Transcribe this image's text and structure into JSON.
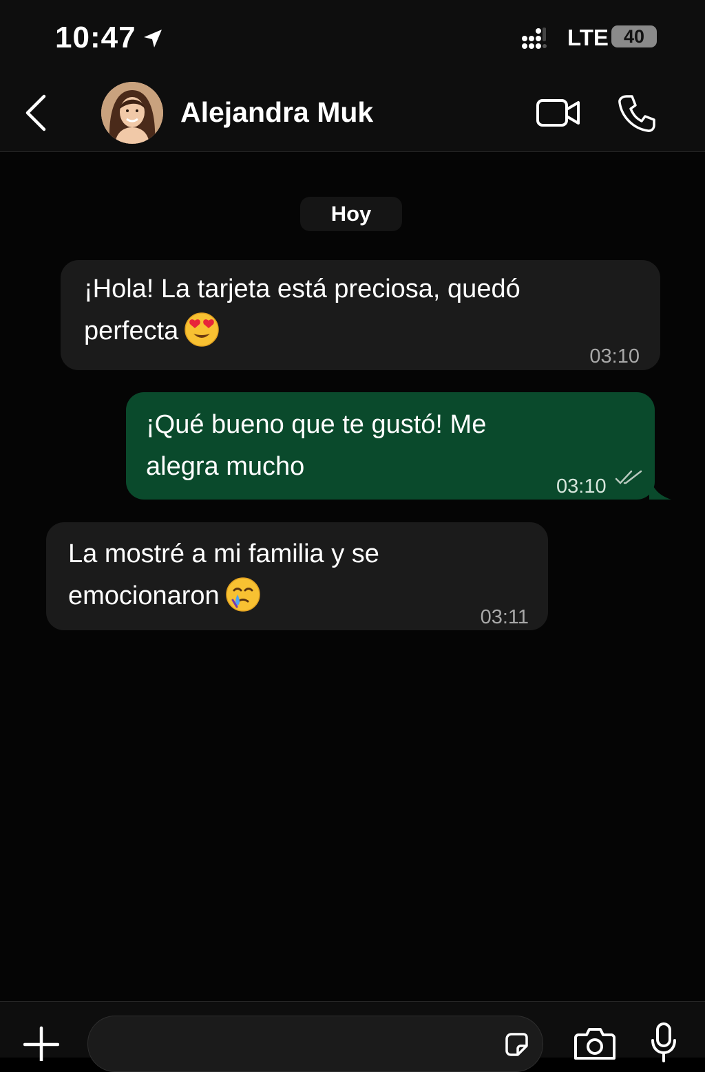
{
  "status_bar": {
    "time": "10:47",
    "network": "LTE",
    "battery": "40"
  },
  "header": {
    "contact_name": "Alejandra Muk"
  },
  "chat": {
    "day_label": "Hoy",
    "messages": [
      {
        "direction": "incoming",
        "line1": "¡Hola! La tarjeta está preciosa, quedó",
        "line2": "perfecta",
        "emoji": "smiling-face-with-heart-eyes",
        "time": "03:10"
      },
      {
        "direction": "outgoing",
        "line1": "¡Qué bueno que te gustó! Me",
        "line2": "alegra mucho",
        "time": "03:10",
        "status": "read"
      },
      {
        "direction": "incoming",
        "line1": "La mostré a mi familia y se",
        "line2": "emocionaron",
        "emoji": "face-holding-back-tears",
        "time": "03:11"
      }
    ]
  },
  "input_bar": {
    "placeholder": ""
  },
  "icons": {
    "location": "location-arrow-icon",
    "signal": "signal-icon",
    "back": "chevron-left-icon",
    "video": "video-camera-icon",
    "phone": "phone-icon",
    "plus": "plus-icon",
    "sticker": "sticker-icon",
    "camera": "camera-icon",
    "mic": "microphone-icon"
  },
  "colors": {
    "outgoing_bubble": "#0a4a2c",
    "incoming_bubble": "#1b1b1b",
    "background": "#000000"
  }
}
